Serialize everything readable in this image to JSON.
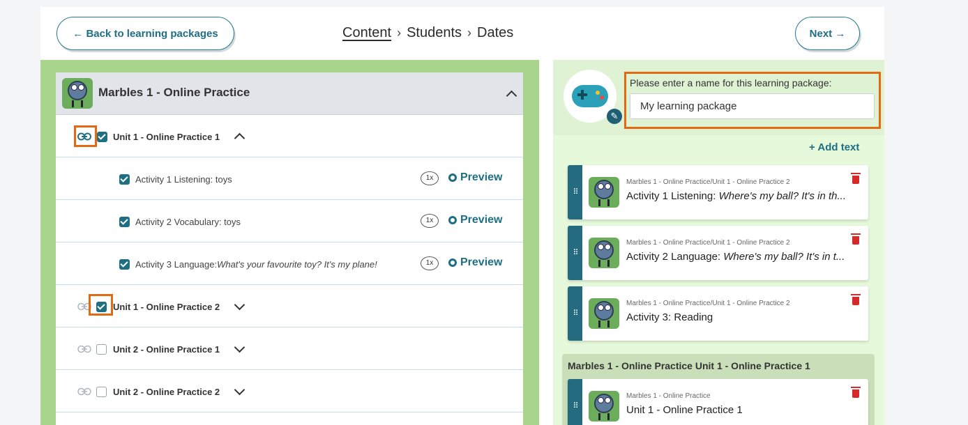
{
  "nav": {
    "back_label": "← Back to learning packages",
    "next_label": "Next →",
    "breadcrumb": [
      "Content",
      "Students",
      "Dates"
    ],
    "separator": "›"
  },
  "content": {
    "package_title": "Marbles 1 - Online Practice",
    "units": [
      {
        "label": "Unit 1 - Online Practice 1",
        "checked": true,
        "expanded": true
      },
      {
        "label": "Unit 1 - Online Practice 2",
        "checked": true,
        "expanded": false
      },
      {
        "label": "Unit 2 - Online Practice 1",
        "checked": false,
        "expanded": false
      },
      {
        "label": "Unit 2 - Online Practice 2",
        "checked": false,
        "expanded": false
      }
    ],
    "activities": [
      {
        "label": "Activity 1 Listening: toys",
        "italic": "",
        "preview": "Preview"
      },
      {
        "label": "Activity 2 Vocabulary: toys",
        "italic": "",
        "preview": "Preview"
      },
      {
        "label": "Activity 3 Language:",
        "italic": "What's your favourite toy? It's my plane!",
        "preview": "Preview"
      }
    ],
    "repeat_badge": "1x"
  },
  "package": {
    "name_label": "Please enter a name for this learning package:",
    "name_value": "My learning package",
    "add_text": "+ Add text",
    "cards": [
      {
        "crumb": "Marbles 1 - Online Practice/Unit 1 - Online Practice 2",
        "title": "Activity 1 Listening: ",
        "title_italic": "Where's my ball? It's in th..."
      },
      {
        "crumb": "Marbles 1 - Online Practice/Unit 1 - Online Practice 2",
        "title": "Activity 2 Language: ",
        "title_italic": "Where's my ball? It's in t..."
      },
      {
        "crumb": "Marbles 1 - Online Practice/Unit 1 - Online Practice 2",
        "title": "Activity 3: Reading",
        "title_italic": ""
      }
    ],
    "group_title": "Marbles 1 - Online Practice Unit 1 - Online Practice 1",
    "group_card": {
      "crumb": "Marbles 1 - Online Practice",
      "title": "Unit 1 - Online Practice 1"
    }
  },
  "colors": {
    "accent": "#1e6f84",
    "highlight": "#e36a12",
    "left_bg": "#a8d48c",
    "right_bg": "#e7f9db"
  }
}
